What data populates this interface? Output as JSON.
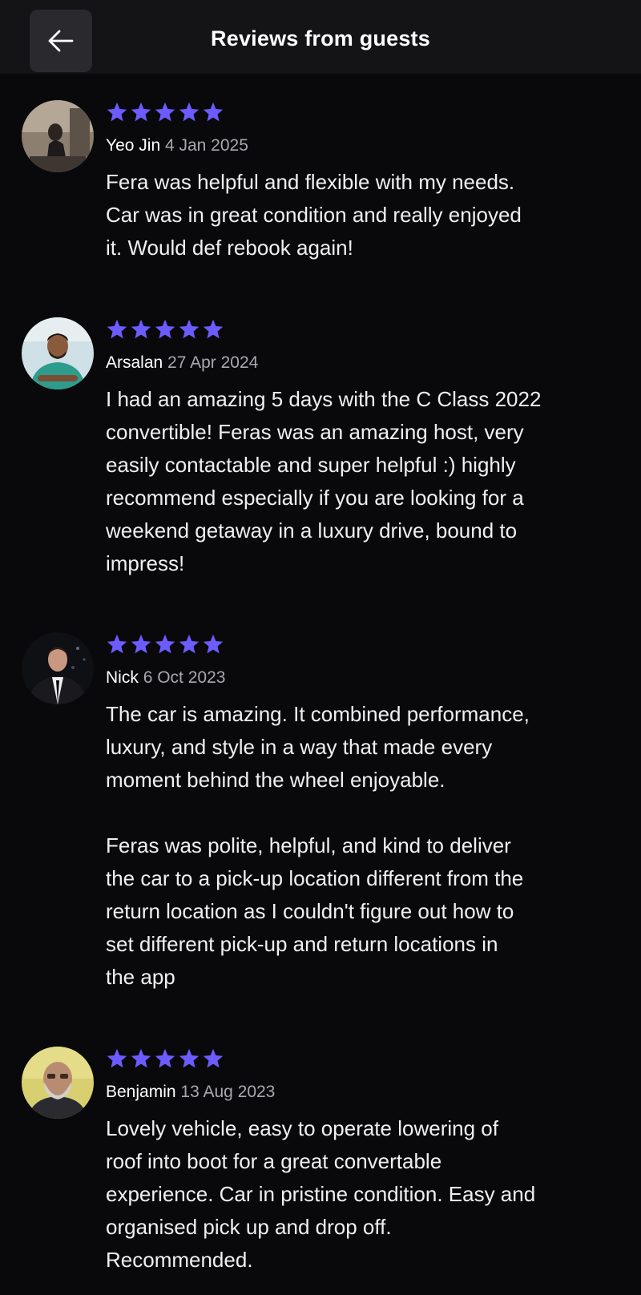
{
  "header": {
    "title": "Reviews from guests",
    "back_icon": "arrow-left-icon"
  },
  "colors": {
    "background": "#09090b",
    "header_background": "#141416",
    "star": "#6c5cff",
    "date_text": "#a8a8ae"
  },
  "reviews": [
    {
      "author": "Yeo Jin",
      "date": "4 Jan 2025",
      "rating": 5,
      "text": "Fera was helpful and flexible with my needs.\nCar was in great condition and really enjoyed\nit. Would def rebook again!"
    },
    {
      "author": "Arsalan",
      "date": "27 Apr 2024",
      "rating": 5,
      "text": "I had an amazing 5 days with the C Class 2022\nconvertible! Feras was an amazing host, very\neasily contactable and super helpful :) highly\nrecommend especially if you are looking for a\nweekend getaway in a luxury drive, bound to\nimpress!"
    },
    {
      "author": "Nick",
      "date": "6 Oct 2023",
      "rating": 5,
      "text": "The car is amazing. It combined performance,\nluxury, and style in a way that made every\nmoment behind the wheel enjoyable.\n\nFeras was polite, helpful, and kind to deliver\nthe car to a pick-up location different from the\nreturn location as I couldn't figure out how to\nset different pick-up and return locations in\nthe app"
    },
    {
      "author": "Benjamin",
      "date": "13 Aug 2023",
      "rating": 5,
      "text": "Lovely vehicle, easy to operate lowering of\nroof into boot for a great convertable\nexperience. Car in pristine condition. Easy and\norganised pick up and drop off.\nRecommended."
    }
  ]
}
